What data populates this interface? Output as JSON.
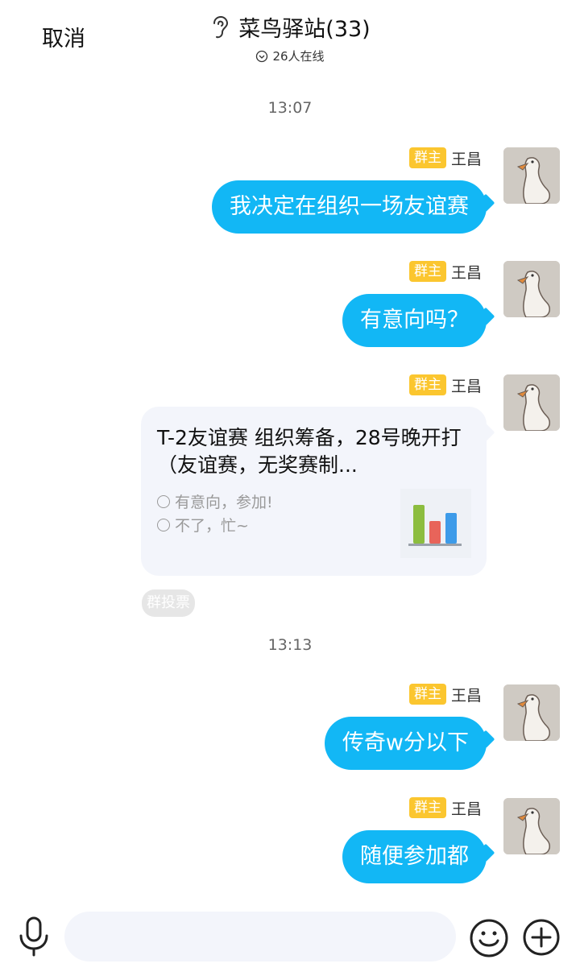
{
  "header": {
    "cancel_label": "取消",
    "group_name": "菜鸟驿站(33)",
    "online_text": "26人在线"
  },
  "messages": [
    {
      "time": "13:07"
    },
    {
      "badge": "群主",
      "sender": "王昌",
      "text": "我决定在组织一场友谊赛"
    },
    {
      "badge": "群主",
      "sender": "王昌",
      "text": "有意向吗？"
    },
    {
      "badge": "群主",
      "sender": "王昌",
      "poll": {
        "title": "T-2友谊赛 组织筹备，28号晚开打 （友谊赛，无奖赛制...",
        "options": [
          "有意向，参加!",
          "不了，忙~"
        ],
        "tag": "群投票"
      }
    },
    {
      "time": "13:13"
    },
    {
      "badge": "群主",
      "sender": "王昌",
      "text": "传奇w分以下"
    },
    {
      "badge": "群主",
      "sender": "王昌",
      "text": "随便参加都"
    }
  ],
  "input": {
    "placeholder": ""
  },
  "colors": {
    "bubble": "#12b7f5",
    "badge": "#fbc62f",
    "poll_bg": "#f3f5fb"
  },
  "icons": [
    "ear-icon",
    "online-check-icon",
    "mic-icon",
    "emoji-icon",
    "plus-icon",
    "chart-icon"
  ]
}
